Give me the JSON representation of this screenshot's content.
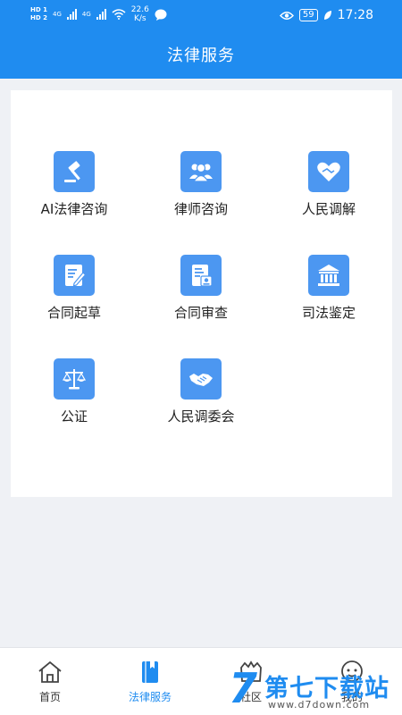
{
  "status_bar": {
    "hd1": "HD 1",
    "hd2": "HD 2",
    "net1": "4G",
    "net2": "4G",
    "speed_value": "22.6",
    "speed_unit": "K/s",
    "battery": "59",
    "time": "17:28",
    "icons": [
      "wifi-icon",
      "chat-icon",
      "eye-icon",
      "leaf-icon"
    ]
  },
  "header": {
    "title": "法律服务"
  },
  "services": [
    {
      "label": "AI法律咨询",
      "icon": "gavel-icon"
    },
    {
      "label": "律师咨询",
      "icon": "lawyers-icon"
    },
    {
      "label": "人民调解",
      "icon": "heart-handshake-icon"
    },
    {
      "label": "合同起草",
      "icon": "document-edit-icon"
    },
    {
      "label": "合同审查",
      "icon": "document-review-icon"
    },
    {
      "label": "司法鉴定",
      "icon": "courthouse-icon"
    },
    {
      "label": "公证",
      "icon": "scales-icon"
    },
    {
      "label": "人民调委会",
      "icon": "handshake-icon"
    }
  ],
  "colors": {
    "primary": "#1f8cf0",
    "icon_bg": "#4c97f1",
    "page_bg": "#eff1f5"
  },
  "tabbar": {
    "tabs": [
      {
        "label": "首页",
        "icon": "home-icon",
        "active": false
      },
      {
        "label": "法律服务",
        "icon": "law-book-icon",
        "active": true
      },
      {
        "label": "社区",
        "icon": "community-icon",
        "active": false
      },
      {
        "label": "我的",
        "icon": "profile-icon",
        "active": false
      }
    ]
  },
  "watermark": {
    "text": "第七下载站",
    "url": "www.d7down.com"
  }
}
